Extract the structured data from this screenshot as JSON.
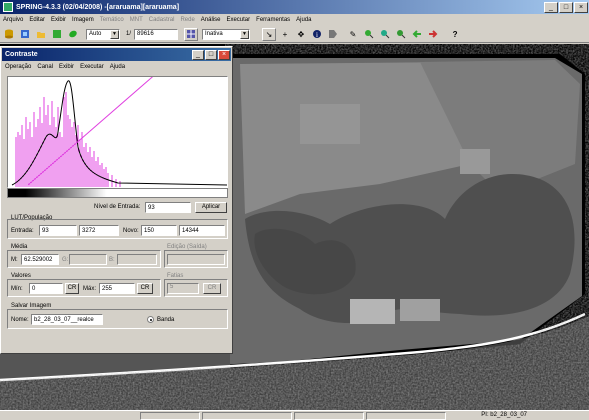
{
  "app": {
    "title": "SPRING-4.3.3 (02/04/2008) -[araruama][araruama]",
    "minimize": "_",
    "maximize": "□",
    "close": "×"
  },
  "menu": [
    {
      "label": "Arquivo",
      "enabled": true
    },
    {
      "label": "Editar",
      "enabled": true
    },
    {
      "label": "Exibir",
      "enabled": true
    },
    {
      "label": "Imagem",
      "enabled": true
    },
    {
      "label": "Temático",
      "enabled": false
    },
    {
      "label": "MNT",
      "enabled": false
    },
    {
      "label": "Cadastral",
      "enabled": false
    },
    {
      "label": "Rede",
      "enabled": false
    },
    {
      "label": "Análise",
      "enabled": true
    },
    {
      "label": "Executar",
      "enabled": true
    },
    {
      "label": "Ferramentas",
      "enabled": true
    },
    {
      "label": "Ajuda",
      "enabled": true
    }
  ],
  "toolbar": {
    "scale_mode": "Auto",
    "scale_prefix": "1/",
    "scale_value": "89616",
    "state": "Inativa",
    "icons": [
      "database-icon",
      "layers-icon",
      "open-icon",
      "tree-icon",
      "leaf-icon",
      "grid-icon",
      "cursor-icon",
      "crosshair-icon",
      "pan-icon",
      "info-icon",
      "tag-icon",
      "edit-pen-icon",
      "zoom-in-icon",
      "zoom-area-icon",
      "zoom-out-icon",
      "back-icon",
      "forward-icon",
      "help-icon"
    ]
  },
  "dialog": {
    "title": "Contraste",
    "menu": [
      "Operação",
      "Canal",
      "Exibir",
      "Executar",
      "Ajuda"
    ],
    "nivel_label": "Nível de Entrada:",
    "nivel_value": "93",
    "aplicar": "Aplicar",
    "lut_label": "LUT/População",
    "entrada_label": "Entrada:",
    "entrada_value": "93",
    "entrada_pop": "3272",
    "novo_label": "Novo:",
    "novo_value": "150",
    "novo_pop": "14344",
    "media_label": "Média",
    "media_r_label": "M:",
    "media_r_value": "62.529002",
    "media_g_label": "G:",
    "media_b_label": "B:",
    "edicao_label": "Edição (Saída)",
    "valores_label": "Valores",
    "min_label": "Mín:",
    "min_value": "0",
    "max_label": "Máx:",
    "max_value": "255",
    "cr_label": "CR",
    "fatias_label": "Fatias",
    "fatias_value": "5",
    "cr2_label": "CR",
    "salvar_label": "Salvar Imagem",
    "nome_label": "Nome:",
    "nome_value": "b2_28_03_07__realce",
    "banda_label": "Banda"
  },
  "status": {
    "right_text": "PI: b2_28_03_07"
  }
}
